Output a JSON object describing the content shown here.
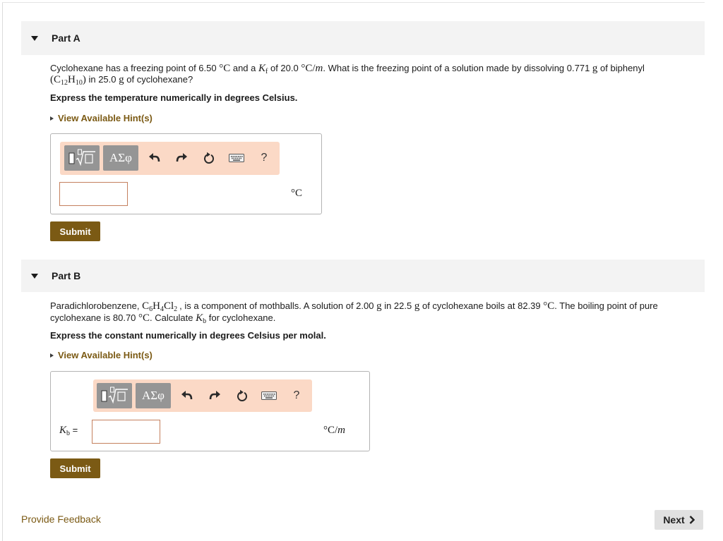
{
  "theme": {
    "accent": "#7b5a14",
    "header_bg": "#f3f3f3",
    "toolbar_bg": "#fbd9c6",
    "input_border": "#c4805e",
    "next_bg": "#e1e1e1"
  },
  "part_a": {
    "toggle_icon": "caret-down-icon",
    "title": "Part A",
    "question": {
      "line1": [
        "Cyclohexane has a freezing point of 6.50 ",
        "°C",
        " and a ",
        "K",
        "f",
        " of 20.0 ",
        "°C/",
        "m",
        ". What is the freezing point of a solution made by dissolving 0.771 ",
        "g",
        " of biphenyl"
      ],
      "line2": [
        "(",
        "C",
        "12",
        "H",
        "10",
        ")",
        " in 25.0 ",
        "g",
        " of cyclohexane?"
      ]
    },
    "instruction": "Express the temperature numerically in degrees Celsius.",
    "hint_toggle": {
      "icon": "caret-right-icon",
      "label": "View Available Hint(s)"
    },
    "answer": {
      "toolbar": {
        "templates_icon": "math-templates-icon",
        "symbols_label": "ΑΣφ",
        "undo_icon": "undo-icon",
        "redo_icon": "redo-icon",
        "reset_icon": "reset-icon",
        "keyboard_icon": "keyboard-icon",
        "help_label": "?"
      },
      "value": "",
      "unit": "°C"
    },
    "submit_label": "Submit"
  },
  "part_b": {
    "toggle_icon": "caret-down-icon",
    "title": "Part B",
    "question": {
      "line1": [
        "Paradichlorobenzene, ",
        "C",
        "6",
        "H",
        "4",
        "Cl",
        "2",
        ", is a component of mothballs. A solution of 2.00 ",
        "g",
        " in 22.5 ",
        "g",
        " of cyclohexane boils at 82.39 ",
        "°C",
        ". The boiling point of pure"
      ],
      "line2": [
        "cyclohexane is 80.70 ",
        "°C",
        ". Calculate ",
        "K",
        "b",
        " for cyclohexane."
      ]
    },
    "instruction": "Express the constant numerically in degrees Celsius per molal.",
    "hint_toggle": {
      "icon": "caret-right-icon",
      "label": "View Available Hint(s)"
    },
    "answer": {
      "toolbar": {
        "templates_icon": "math-templates-icon",
        "symbols_label": "ΑΣφ",
        "undo_icon": "undo-icon",
        "redo_icon": "redo-icon",
        "reset_icon": "reset-icon",
        "keyboard_icon": "keyboard-icon",
        "help_label": "?"
      },
      "label": {
        "symbol": "K",
        "subscript": "b",
        "equals": " ="
      },
      "value": "",
      "unit": {
        "main": "°C/",
        "var": "m"
      }
    },
    "submit_label": "Submit"
  },
  "footer": {
    "feedback_link": "Provide Feedback",
    "next_label": "Next",
    "next_icon": "chevron-right-icon"
  }
}
